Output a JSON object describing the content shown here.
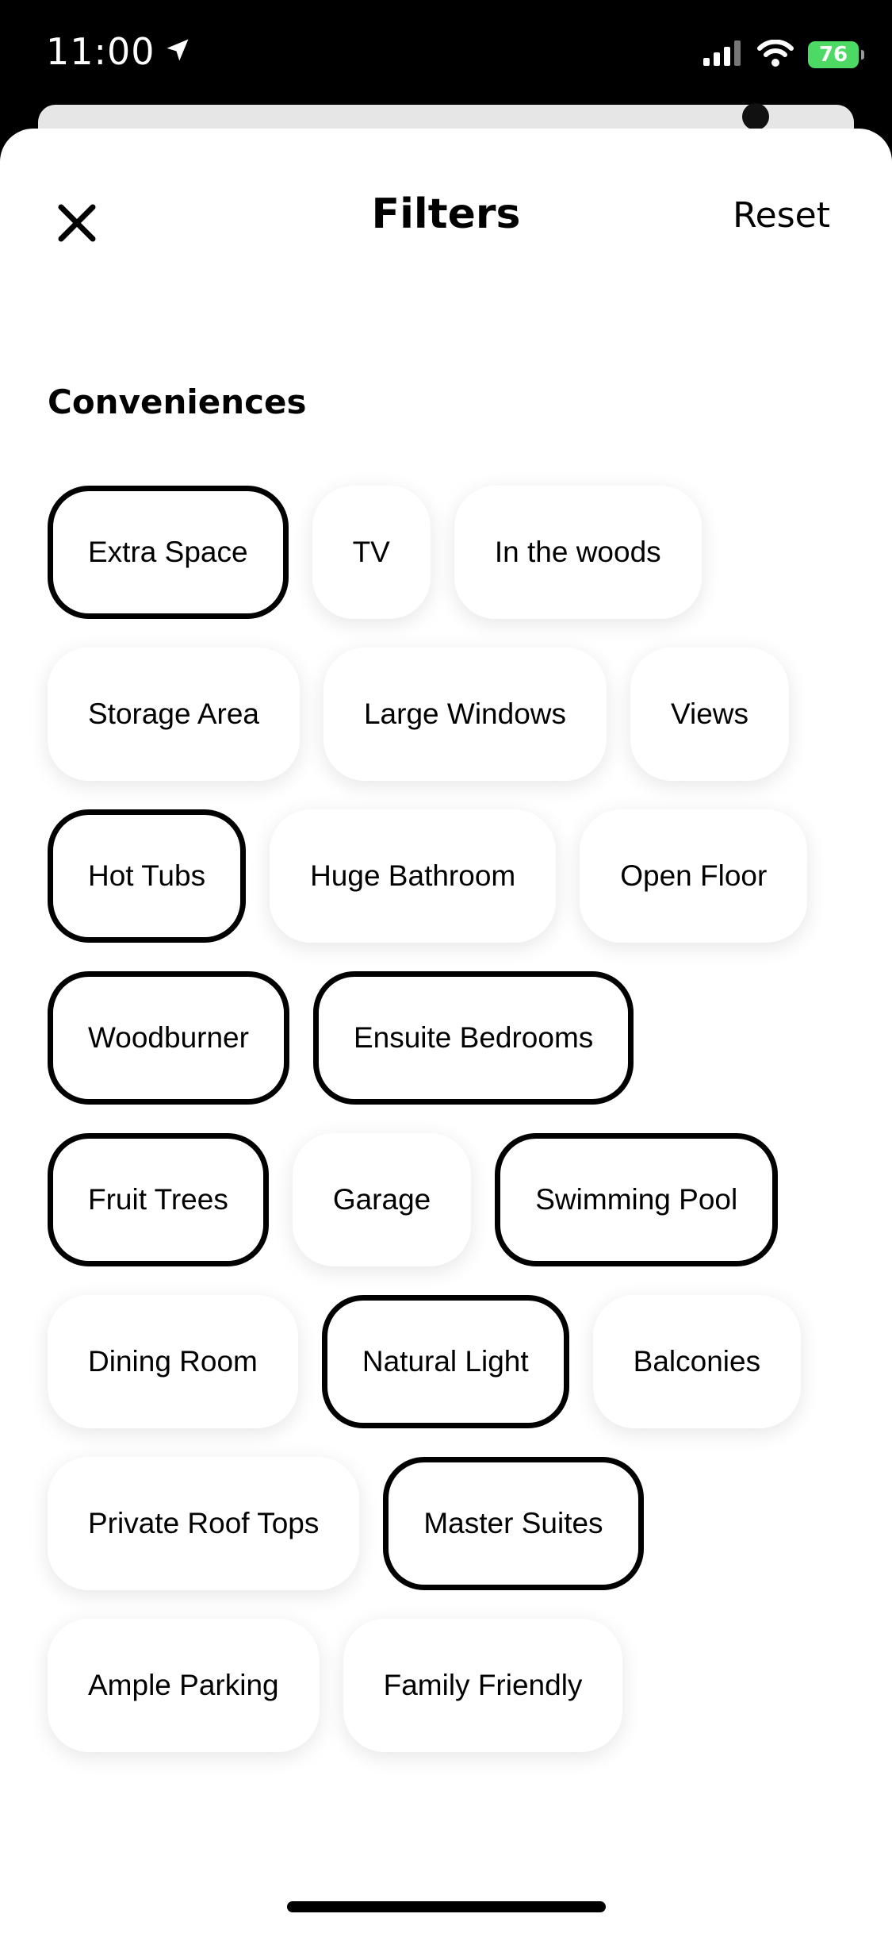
{
  "status_bar": {
    "time": "11:00",
    "battery": "76",
    "location_icon": "location-arrow-icon",
    "signal_icon": "cellular-signal-icon",
    "wifi_icon": "wifi-icon",
    "battery_icon": "battery-charging-icon"
  },
  "header": {
    "title": "Filters",
    "reset_label": "Reset",
    "close_icon": "close-icon"
  },
  "section": {
    "title": "Conveniences"
  },
  "chips": [
    {
      "label": "Extra Space",
      "selected": true
    },
    {
      "label": "TV",
      "selected": false
    },
    {
      "label": "In the woods",
      "selected": false
    },
    {
      "label": "Storage Area",
      "selected": false
    },
    {
      "label": "Large Windows",
      "selected": false
    },
    {
      "label": "Views",
      "selected": false
    },
    {
      "label": "Hot Tubs",
      "selected": true
    },
    {
      "label": "Huge Bathroom",
      "selected": false
    },
    {
      "label": "Open Floor",
      "selected": false
    },
    {
      "label": "Woodburner",
      "selected": true
    },
    {
      "label": "Ensuite Bedrooms",
      "selected": true
    },
    {
      "label": "Fruit Trees",
      "selected": true
    },
    {
      "label": "Garage",
      "selected": false
    },
    {
      "label": "Swimming Pool",
      "selected": true
    },
    {
      "label": "Dining Room",
      "selected": false
    },
    {
      "label": "Natural Light",
      "selected": true
    },
    {
      "label": "Balconies",
      "selected": false
    },
    {
      "label": "Private Roof Tops",
      "selected": false
    },
    {
      "label": "Master Suites",
      "selected": true
    },
    {
      "label": "Ample Parking",
      "selected": false
    },
    {
      "label": "Family Friendly",
      "selected": false
    }
  ],
  "colors": {
    "selected_border": "#000000",
    "chip_background": "#ffffff",
    "battery_green": "#4cd964"
  }
}
